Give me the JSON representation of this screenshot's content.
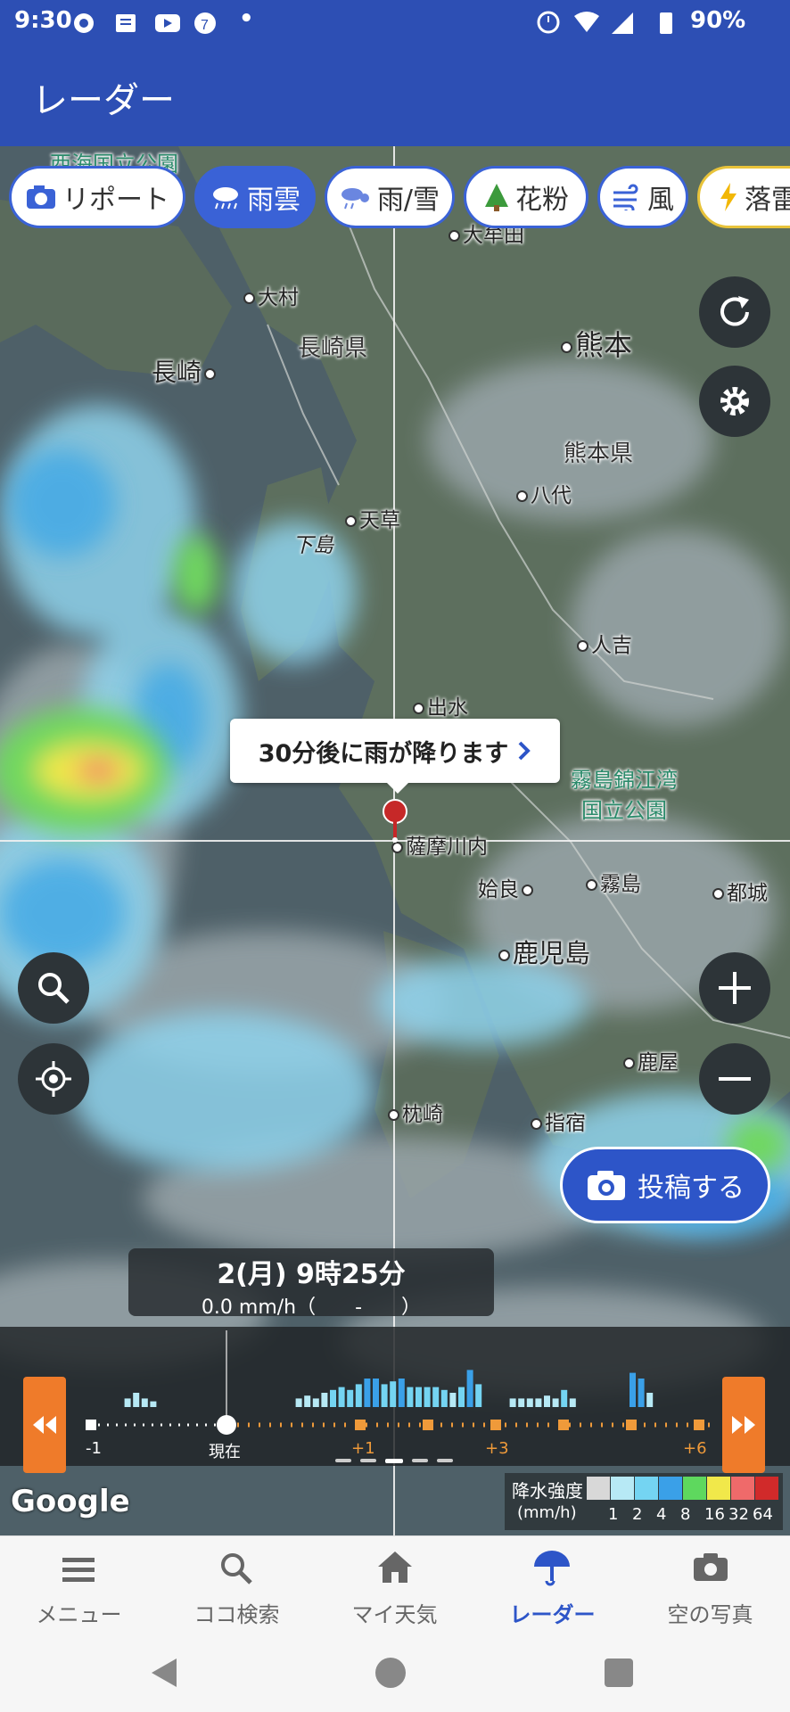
{
  "status_bar": {
    "time": "9:30",
    "dot": "•",
    "battery": "90%",
    "icons": [
      "chrome-icon",
      "news-icon",
      "youtube-icon",
      "seven-eleven-icon",
      "alarm-icon",
      "wifi-icon",
      "signal-icon",
      "battery-icon"
    ]
  },
  "app_bar": {
    "title": "レーダー"
  },
  "chips": [
    {
      "label": "リポート",
      "icon": "camera-icon"
    },
    {
      "label": "雨雲",
      "icon": "rain-cloud-icon",
      "active": true
    },
    {
      "label": "雨/雪",
      "icon": "rain-snow-icon"
    },
    {
      "label": "花粉",
      "icon": "tree-icon"
    },
    {
      "label": "風",
      "icon": "wind-icon"
    },
    {
      "label": "落雷",
      "icon": "lightning-icon"
    }
  ],
  "map": {
    "places": {
      "nagasaki": "長崎",
      "omura": "大村",
      "nagasaki_pref": "長崎県",
      "kumamoto": "熊本",
      "kumamoto_pref": "熊本県",
      "yatsushiro": "八代",
      "amakusa": "天草",
      "shimoshima": "下島",
      "hitoyoshi": "人吉",
      "izumi": "出水",
      "park": "霧島錦江湾\n国立公園",
      "satsumasendai": "薩摩川内",
      "aira": "姶良",
      "kirishima": "霧島",
      "miyakonojo": "都城",
      "kagoshima": "鹿児島",
      "kanoya": "鹿屋",
      "makurazaki": "枕崎",
      "ibusuki": "指宿",
      "top_park": "西海国立公園",
      "omuta": "大牟田"
    },
    "attribution": "Google"
  },
  "popup": {
    "text": "30分後に雨が降ります"
  },
  "post_button": {
    "label": "投稿する"
  },
  "time_box": {
    "datetime": "2(月) 9時25分",
    "intensity": "0.0 mm/h（　　-　　）"
  },
  "timeline": {
    "ticks": [
      "-1",
      "現在",
      "+1",
      "+3",
      "+6"
    ],
    "bars": [
      0,
      3,
      5,
      3,
      2,
      0,
      0,
      0,
      0,
      0,
      0,
      0,
      0,
      0,
      0,
      0,
      0,
      0,
      0,
      0,
      0,
      3,
      4,
      3,
      5,
      6,
      7,
      6,
      8,
      10,
      10,
      8,
      9,
      10,
      7,
      7,
      7,
      7,
      6,
      5,
      7,
      13,
      8,
      0,
      0,
      0,
      3,
      3,
      3,
      3,
      4,
      3,
      6,
      3,
      0,
      0,
      0,
      0,
      0,
      0,
      12,
      10,
      5,
      0,
      0,
      0
    ],
    "current_index_fraction": 0.18
  },
  "legend": {
    "title": "降水強度",
    "unit": "(mm/h)",
    "values": [
      "1",
      "2",
      "4",
      "8",
      "16",
      "32",
      "64"
    ],
    "colors": [
      "#d8d8d8",
      "#b7e9f5",
      "#74d4f2",
      "#3aa0e8",
      "#5ed85e",
      "#f1e84a",
      "#ef6a6a",
      "#d12a2a"
    ]
  },
  "bottom_nav": [
    {
      "label": "メニュー",
      "icon": "menu-icon"
    },
    {
      "label": "ココ検索",
      "icon": "search-icon"
    },
    {
      "label": "マイ天気",
      "icon": "home-icon"
    },
    {
      "label": "レーダー",
      "icon": "radar-umbrella-icon",
      "active": true
    },
    {
      "label": "空の写真",
      "icon": "camera-icon"
    }
  ],
  "colors": {
    "brand": "#2d4fb4",
    "accent": "#2d55c8",
    "timeline_orange": "#ef7b2a"
  }
}
